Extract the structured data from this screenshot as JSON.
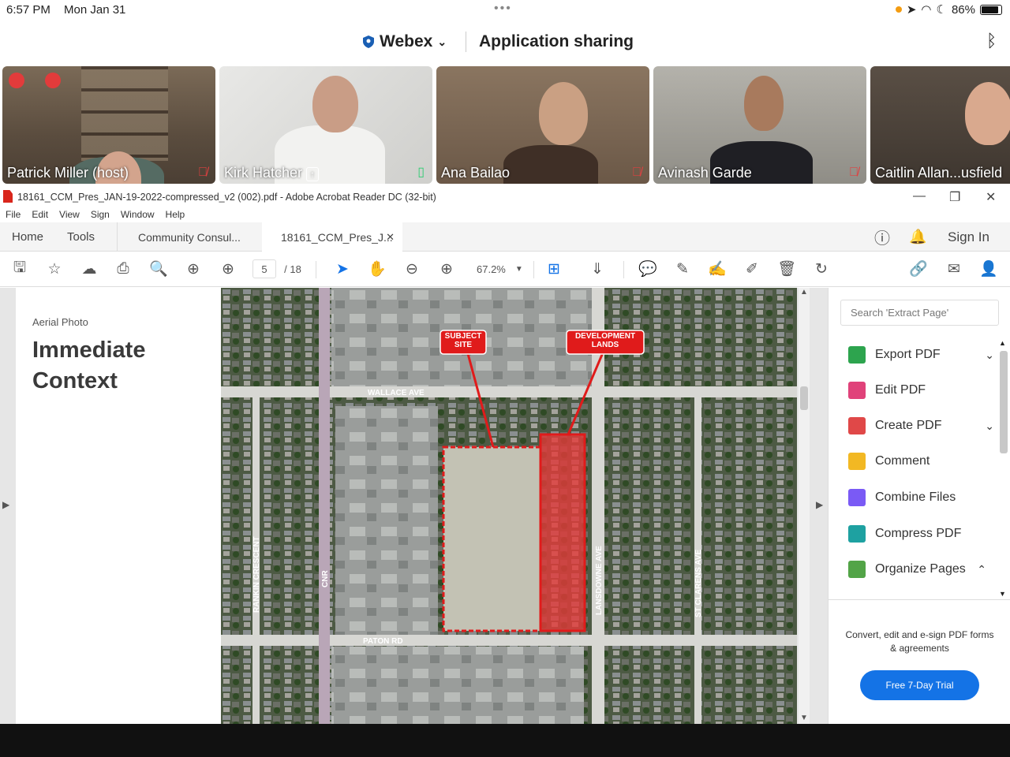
{
  "status_bar": {
    "time": "6:57 PM",
    "date": "Mon Jan 31",
    "battery": "86%",
    "battery_level": 0.86
  },
  "webex": {
    "app_name": "Webex",
    "title": "Application sharing"
  },
  "participants": [
    {
      "name": "Patrick Miller (host)",
      "mic": "muted"
    },
    {
      "name": "Kirk Hatcher",
      "mic": "active",
      "sharing": true
    },
    {
      "name": "Ana Bailao",
      "mic": "muted"
    },
    {
      "name": "Avinash Garde",
      "mic": "muted"
    },
    {
      "name": "Caitlin Allan...usfield",
      "mic": ""
    }
  ],
  "acrobat": {
    "window_title": "18161_CCM_Pres_JAN-19-2022-compressed_v2 (002).pdf - Adobe Acrobat Reader DC (32-bit)",
    "menu": [
      "File",
      "Edit",
      "View",
      "Sign",
      "Window",
      "Help"
    ],
    "tabs": {
      "home": "Home",
      "tools": "Tools",
      "doc1": "Community Consul...",
      "doc2": "18161_CCM_Pres_J..."
    },
    "sign_in": "Sign In",
    "page_current": "5",
    "page_total": "/ 18",
    "zoom": "67.2%"
  },
  "pdf_page": {
    "kicker": "Aerial Photo",
    "heading_line1": "Immediate",
    "heading_line2": "Context",
    "callouts": {
      "subject_site": "SUBJECT SITE",
      "development_lands": "DEVELOPMENT LANDS"
    },
    "street_labels": {
      "wallace": "WALLACE AVE",
      "paton": "PATON RD",
      "lansdowne": "LANSDOWNE AVE",
      "rankin": "RANKIN CRESCENT",
      "cnr": "CNR",
      "st_clarens": "ST CLARENS AVE"
    }
  },
  "right_pane": {
    "search_placeholder": "Search 'Extract Page'",
    "tools": [
      {
        "label": "Export PDF",
        "color": "#2da44e",
        "chevron": "down"
      },
      {
        "label": "Edit PDF",
        "color": "#e0427a",
        "chevron": ""
      },
      {
        "label": "Create PDF",
        "color": "#e04848",
        "chevron": "down"
      },
      {
        "label": "Comment",
        "color": "#f2b823",
        "chevron": ""
      },
      {
        "label": "Combine Files",
        "color": "#7a5af5",
        "chevron": ""
      },
      {
        "label": "Compress PDF",
        "color": "#1ea1a1",
        "chevron": ""
      },
      {
        "label": "Organize Pages",
        "color": "#52a447",
        "chevron": "up"
      }
    ],
    "promo": "Convert, edit and e-sign PDF forms & agreements",
    "trial_button": "Free 7-Day Trial"
  }
}
